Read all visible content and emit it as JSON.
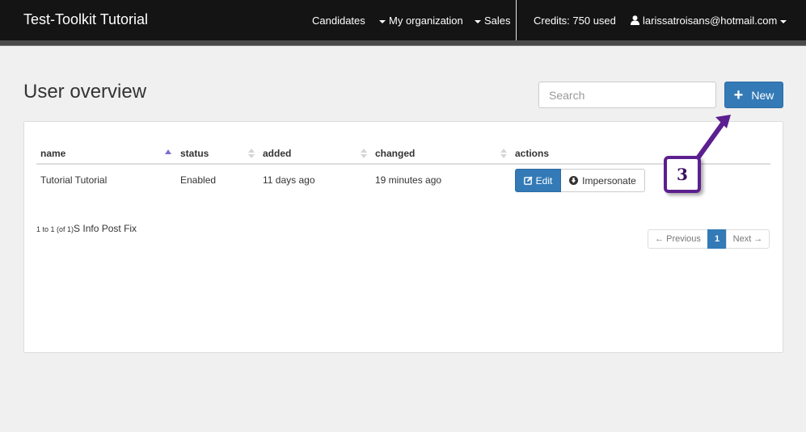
{
  "navbar": {
    "brand": "Test-Toolkit Tutorial",
    "candidates": "Candidates",
    "my_organization": "My organization",
    "sales": "Sales",
    "credits": "Credits: 750 used",
    "user": "larissatroisans@hotmail.com"
  },
  "page": {
    "title": "User overview",
    "search_placeholder": "Search",
    "new_label": "New"
  },
  "table": {
    "columns": [
      "name",
      "status",
      "added",
      "changed",
      "actions"
    ],
    "rows": [
      {
        "name": "Tutorial Tutorial",
        "status": "Enabled",
        "added": "11 days ago",
        "changed": "19 minutes ago",
        "edit_label": "Edit",
        "impersonate_label": "Impersonate"
      }
    ]
  },
  "info": {
    "range": "1 to 1 (of 1)",
    "suffix": "S Info Post Fix"
  },
  "pagination": {
    "previous": "← Previous",
    "current": "1",
    "next": "Next →"
  },
  "annotation": {
    "step": "3"
  },
  "colors": {
    "primary": "#337ab7",
    "navbar": "#141414",
    "annotation": "#5c1f8f"
  }
}
